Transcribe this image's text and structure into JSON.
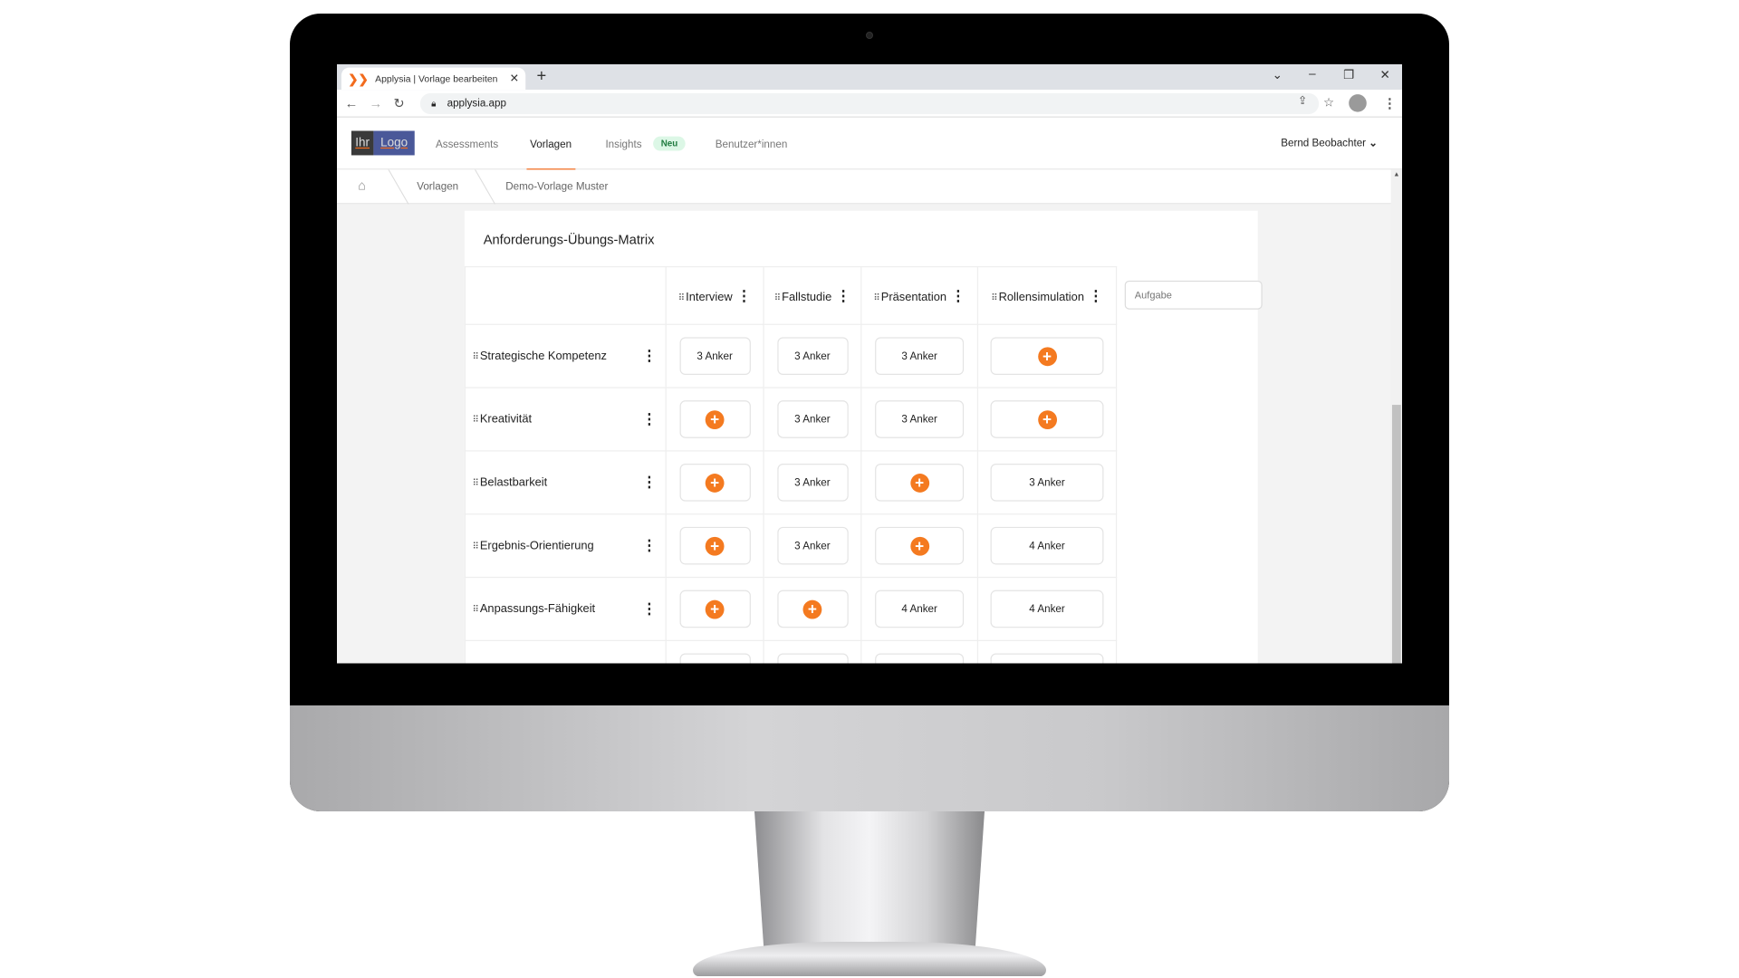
{
  "browser": {
    "tab_title": "Applysia | Vorlage bearbeiten",
    "url": "applysia.app"
  },
  "nav": {
    "logo_left": "Ihr",
    "logo_right": "Logo",
    "items": [
      {
        "label": "Assessments"
      },
      {
        "label": "Vorlagen",
        "active": true
      },
      {
        "label": "Insights",
        "badge": "Neu"
      },
      {
        "label": "Benutzer*innen"
      }
    ],
    "user": "Bernd Beobachter"
  },
  "breadcrumb": [
    "Vorlagen",
    "Demo-Vorlage Muster"
  ],
  "matrix": {
    "title": "Anforderungs-Übungs-Matrix",
    "columns": [
      "Interview",
      "Fallstudie",
      "Präsentation",
      "Rollensimulation"
    ],
    "new_column_placeholder": "Aufgabe",
    "rows": [
      {
        "label": "Strategische Kompetenz",
        "cells": [
          "3 Anker",
          "3 Anker",
          "3 Anker",
          null
        ]
      },
      {
        "label": "Kreativität",
        "cells": [
          null,
          "3 Anker",
          "3 Anker",
          null
        ]
      },
      {
        "label": "Belastbarkeit",
        "cells": [
          null,
          "3 Anker",
          null,
          "3 Anker"
        ]
      },
      {
        "label": "Ergebnis-Orientierung",
        "cells": [
          null,
          "3 Anker",
          null,
          "4 Anker"
        ]
      },
      {
        "label": "Anpassungs-Fähigkeit",
        "cells": [
          null,
          null,
          "4 Anker",
          "4 Anker"
        ]
      }
    ]
  },
  "colors": {
    "accent": "#f47a20",
    "badge_bg": "#dcf7e6"
  }
}
